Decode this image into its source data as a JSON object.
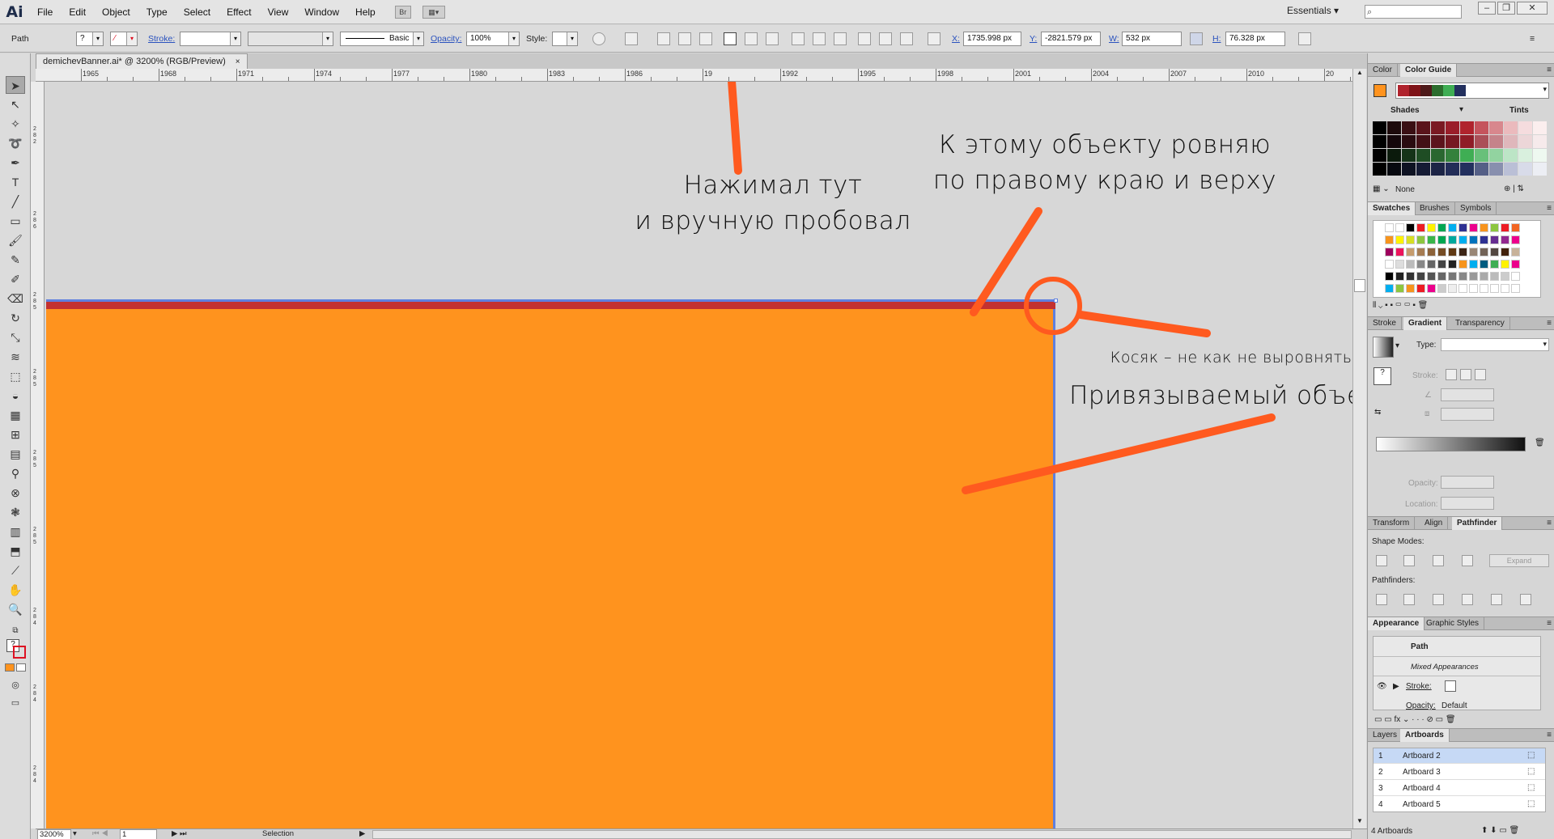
{
  "app": {
    "logo": "Ai"
  },
  "menu": [
    "File",
    "Edit",
    "Object",
    "Type",
    "Select",
    "Effect",
    "View",
    "Window",
    "Help"
  ],
  "menu_buttons": {
    "bridge": "Br"
  },
  "workspace": "Essentials",
  "search_placeholder": "",
  "control_bar": {
    "selection_label": "Path",
    "stroke_label": "Stroke:",
    "brush_label": "Basic",
    "opacity_label": "Opacity:",
    "opacity_value": "100%",
    "style_label": "Style:",
    "x_label": "X:",
    "x_value": "1735.998 px",
    "y_label": "Y:",
    "y_value": "-2821.579 px",
    "w_label": "W:",
    "w_value": "532 px",
    "h_label": "H:",
    "h_value": "76.328 px"
  },
  "document_tab": {
    "title": "demichevBanner.ai* @ 3200% (RGB/Preview)",
    "close": "×"
  },
  "ruler_top_labels": [
    "1965",
    "1968",
    "1971",
    "1974",
    "1977",
    "1980",
    "1983",
    "1986",
    "19",
    "1992",
    "1995",
    "1998",
    "2001",
    "2004",
    "2007",
    "2010",
    "20"
  ],
  "annotations": {
    "clicked_here": "Нажимал тут\nи вручную пробовал",
    "align_to": "К этому объекту ровняю\nпо правому краю и верху",
    "glitch": "Косяк – не как не выровнять",
    "linked_object": "Привязываемый объект"
  },
  "colors": {
    "orange": "#ff931e",
    "red_bar": "#c33130",
    "selection_blue": "#5f80df",
    "annotation_orange": "#ff5a1f"
  },
  "status_bar": {
    "zoom": "3200%",
    "artboard_num": "1",
    "tool": "Selection"
  },
  "panels": {
    "color_tabs": [
      "Color",
      "Color Guide"
    ],
    "shades_label": "Shades",
    "tints_label": "Tints",
    "none_label": "None",
    "swatches_tabs": [
      "Swatches",
      "Brushes",
      "Symbols"
    ],
    "gradient_tabs": [
      "Stroke",
      "Gradient",
      "Transparency"
    ],
    "gradient_type_label": "Type:",
    "gradient_stroke_label": "Stroke:",
    "gradient_opacity_label": "Opacity:",
    "gradient_location_label": "Location:",
    "pathfinder_tabs": [
      "Transform",
      "Align",
      "Pathfinder"
    ],
    "shape_modes_label": "Shape Modes:",
    "expand_label": "Expand",
    "pathfinders_label": "Pathfinders:",
    "appearance_tabs": [
      "Appearance",
      "Graphic Styles"
    ],
    "appearance_title": "Path",
    "mixed_label": "Mixed Appearances",
    "stroke_row": "Stroke:",
    "opacity_row": "Opacity:",
    "opacity_default": "Default",
    "artboards_tabs": [
      "Layers",
      "Artboards"
    ],
    "artboards": [
      {
        "num": "1",
        "name": "Artboard 2"
      },
      {
        "num": "2",
        "name": "Artboard 3"
      },
      {
        "num": "3",
        "name": "Artboard 4"
      },
      {
        "num": "4",
        "name": "Artboard 5"
      }
    ],
    "artboards_count": "4 Artboards"
  }
}
